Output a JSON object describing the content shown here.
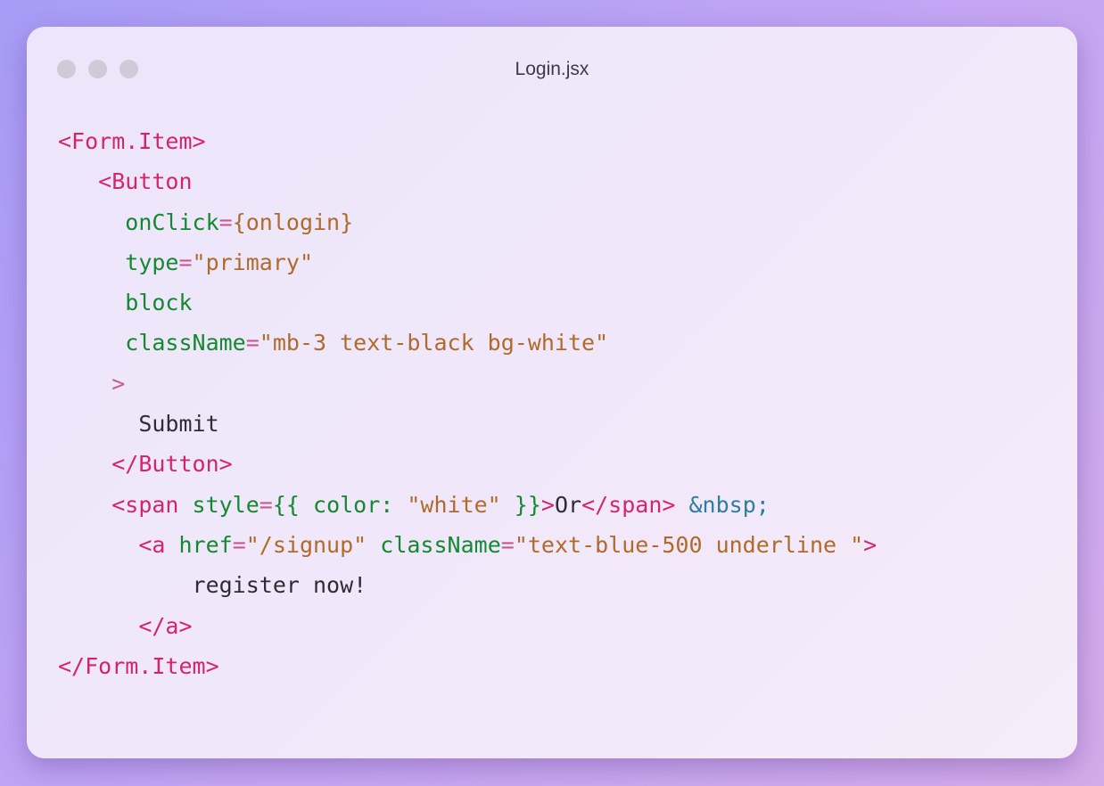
{
  "window": {
    "title": "Login.jsx"
  },
  "colors": {
    "tag": "#d6246b",
    "attribute": "#14892f",
    "punctuation": "#c95a8e",
    "string": "#b06a2a",
    "text": "#2d2d33",
    "entity": "#2a7ea0"
  },
  "code": {
    "lines": [
      {
        "indent": "",
        "tokens": [
          {
            "cls": "t-tag",
            "text": "<Form.Item>"
          }
        ]
      },
      {
        "indent": "   ",
        "tokens": [
          {
            "cls": "t-tag",
            "text": "<Button"
          }
        ]
      },
      {
        "indent": "     ",
        "tokens": [
          {
            "cls": "t-attr",
            "text": "onClick"
          },
          {
            "cls": "t-punc",
            "text": "="
          },
          {
            "cls": "t-str",
            "text": "{onlogin}"
          }
        ]
      },
      {
        "indent": "     ",
        "tokens": [
          {
            "cls": "t-attr",
            "text": "type"
          },
          {
            "cls": "t-punc",
            "text": "="
          },
          {
            "cls": "t-str",
            "text": "\"primary\""
          }
        ]
      },
      {
        "indent": "     ",
        "tokens": [
          {
            "cls": "t-attr",
            "text": "block"
          }
        ]
      },
      {
        "indent": "     ",
        "tokens": [
          {
            "cls": "t-attr",
            "text": "className"
          },
          {
            "cls": "t-punc",
            "text": "="
          },
          {
            "cls": "t-str",
            "text": "\"mb-3 text-black bg-white\""
          }
        ]
      },
      {
        "indent": "    ",
        "tokens": [
          {
            "cls": "t-punc",
            "text": ">"
          }
        ]
      },
      {
        "indent": "      ",
        "tokens": [
          {
            "cls": "t-text",
            "text": "Submit"
          }
        ]
      },
      {
        "indent": "    ",
        "tokens": [
          {
            "cls": "t-tag",
            "text": "</Button>"
          }
        ]
      },
      {
        "indent": "    ",
        "tokens": [
          {
            "cls": "t-tag",
            "text": "<span "
          },
          {
            "cls": "t-attr",
            "text": "style"
          },
          {
            "cls": "t-punc",
            "text": "="
          },
          {
            "cls": "t-attr",
            "text": "{{ color: "
          },
          {
            "cls": "t-str",
            "text": "\"white\""
          },
          {
            "cls": "t-attr",
            "text": " }}"
          },
          {
            "cls": "t-tag",
            "text": ">"
          },
          {
            "cls": "t-text",
            "text": "Or"
          },
          {
            "cls": "t-tag",
            "text": "</span>"
          },
          {
            "cls": "t-text",
            "text": " "
          },
          {
            "cls": "t-ent",
            "text": "&nbsp;"
          }
        ]
      },
      {
        "indent": "      ",
        "tokens": [
          {
            "cls": "t-tag",
            "text": "<a "
          },
          {
            "cls": "t-attr",
            "text": "href"
          },
          {
            "cls": "t-punc",
            "text": "="
          },
          {
            "cls": "t-str",
            "text": "\"/signup\""
          },
          {
            "cls": "t-text",
            "text": " "
          },
          {
            "cls": "t-attr",
            "text": "className"
          },
          {
            "cls": "t-punc",
            "text": "="
          },
          {
            "cls": "t-str",
            "text": "\"text-blue-500 underline \""
          },
          {
            "cls": "t-tag",
            "text": ">"
          }
        ]
      },
      {
        "indent": "          ",
        "tokens": [
          {
            "cls": "t-text",
            "text": "register now!"
          }
        ]
      },
      {
        "indent": "      ",
        "tokens": [
          {
            "cls": "t-tag",
            "text": "</a>"
          }
        ]
      },
      {
        "indent": "",
        "tokens": [
          {
            "cls": "t-tag",
            "text": "</Form.Item>"
          }
        ]
      }
    ]
  }
}
